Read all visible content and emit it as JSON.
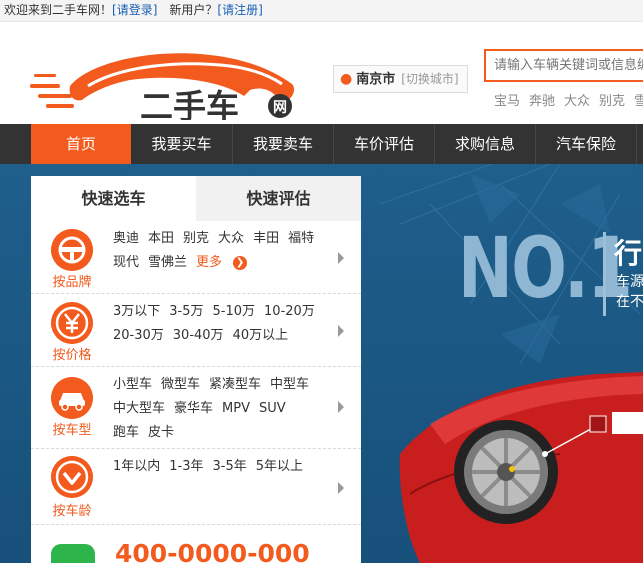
{
  "topbar": {
    "welcome": "欢迎来到二手车网！",
    "login": "[请登录]",
    "new_user": "新用户？",
    "register": "[请注册]"
  },
  "header": {
    "logo_text": "二手车网",
    "city": "南京市",
    "switch_city": "[切换城市]",
    "search_placeholder": "请输入车辆关键词或信息编号",
    "hot_words": [
      "宝马",
      "奔驰",
      "大众",
      "别克",
      "雪佛兰"
    ]
  },
  "nav": {
    "items": [
      "首页",
      "我要买车",
      "我要卖车",
      "车价评估",
      "求购信息",
      "汽车保险"
    ]
  },
  "banner": {
    "headline": "NO.1",
    "slogan_title": "行业领先",
    "slogan_lines": [
      "车源丰富",
      "在不断更新"
    ]
  },
  "panel": {
    "tabs": [
      "快速选车",
      "快速评估"
    ],
    "rows": [
      {
        "label": "按品牌",
        "icon": "steering-wheel-icon",
        "options": [
          "奥迪",
          "本田",
          "别克",
          "大众",
          "丰田",
          "福特",
          "现代",
          "雪佛兰"
        ],
        "more": "更多"
      },
      {
        "label": "按价格",
        "icon": "yen-icon",
        "options": [
          "3万以下",
          "3-5万",
          "5-10万",
          "10-20万",
          "20-30万",
          "30-40万",
          "40万以上"
        ]
      },
      {
        "label": "按车型",
        "icon": "car-icon",
        "options": [
          "小型车",
          "微型车",
          "紧凑型车",
          "中型车",
          "中大型车",
          "豪华车",
          "MPV",
          "SUV",
          "跑车",
          "皮卡"
        ]
      },
      {
        "label": "按车龄",
        "icon": "chevron-down-icon",
        "options": [
          "1年以内",
          "1-3年",
          "3-5年",
          "5年以上"
        ]
      }
    ],
    "hotline": "400-0000-000"
  },
  "colors": {
    "accent": "#f25a1e",
    "nav_bg": "#333333",
    "banner_bg": "#1b5984"
  }
}
